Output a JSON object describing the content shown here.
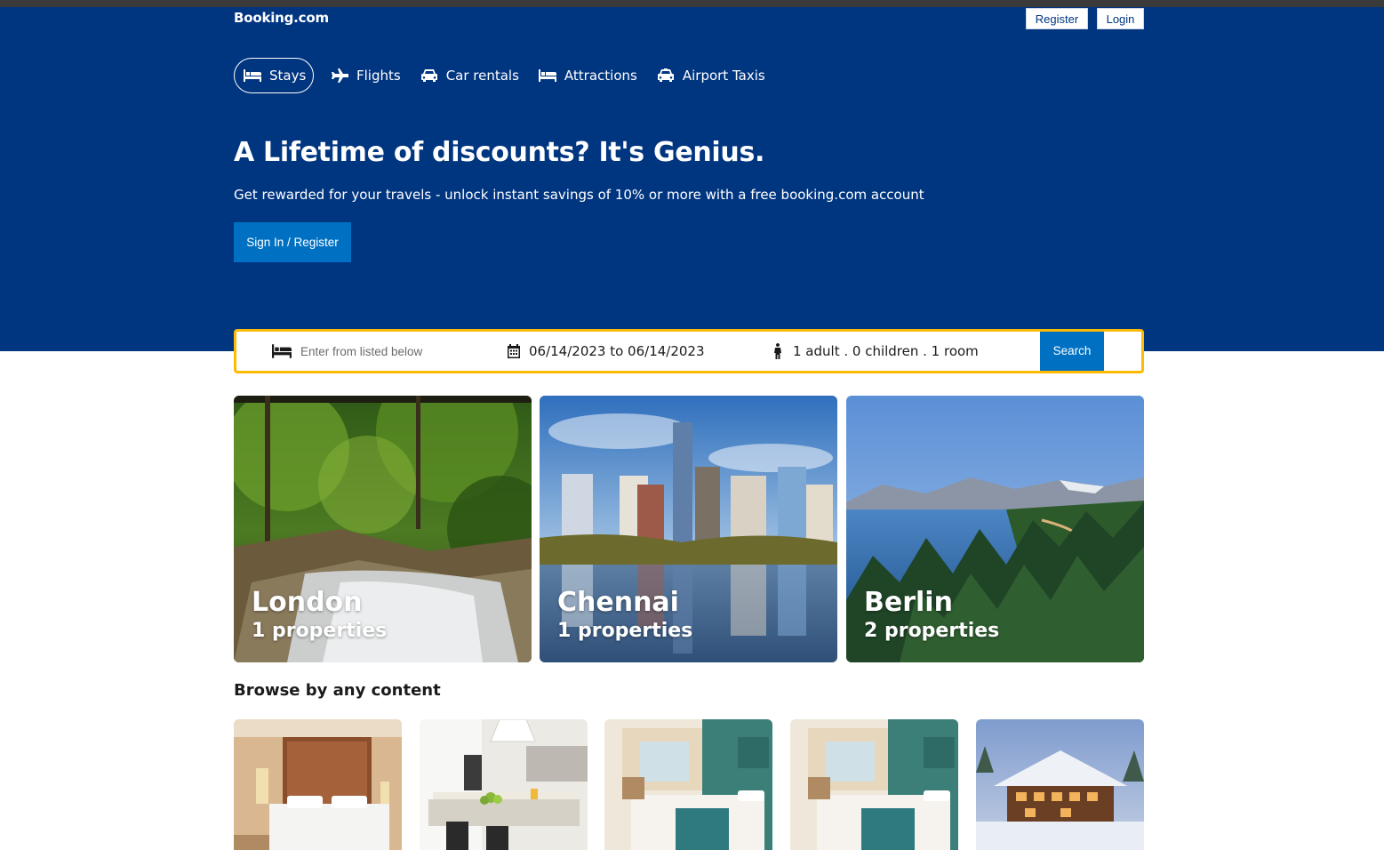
{
  "header": {
    "brand": "Booking.com",
    "register_label": "Register",
    "login_label": "Login"
  },
  "nav": {
    "items": [
      {
        "label": "Stays",
        "icon": "bed-icon",
        "active": true
      },
      {
        "label": "Flights",
        "icon": "plane-icon",
        "active": false
      },
      {
        "label": "Car rentals",
        "icon": "car-icon",
        "active": false
      },
      {
        "label": "Attractions",
        "icon": "bed-icon",
        "active": false
      },
      {
        "label": "Airport Taxis",
        "icon": "taxi-icon",
        "active": false
      }
    ]
  },
  "hero": {
    "title": "A Lifetime of discounts? It's Genius.",
    "subtitle": "Get rewarded for your travels - unlock instant savings of 10% or more with a free booking.com account",
    "cta_label": "Sign In / Register"
  },
  "search": {
    "destination_placeholder": "Enter from listed below",
    "dates": "06/14/2023 to 06/14/2023",
    "guests": "1 adult . 0 children . 1 room",
    "button_label": "Search"
  },
  "cities": [
    {
      "name": "London",
      "count": "1 properties",
      "scene": "forest-waterfall"
    },
    {
      "name": "Chennai",
      "count": "1 properties",
      "scene": "city-skyline-river"
    },
    {
      "name": "Berlin",
      "count": "2 properties",
      "scene": "lake-mountains-pines"
    }
  ],
  "browse": {
    "title": "Browse by any content",
    "items": [
      {
        "scene": "hotel-bedroom-wood"
      },
      {
        "scene": "white-kitchen"
      },
      {
        "scene": "teal-hotel-room"
      },
      {
        "scene": "teal-hotel-room"
      },
      {
        "scene": "snowy-chalet"
      }
    ]
  },
  "colors": {
    "brand_blue": "#003580",
    "button_blue": "#0071c2",
    "search_border": "#febb02"
  }
}
